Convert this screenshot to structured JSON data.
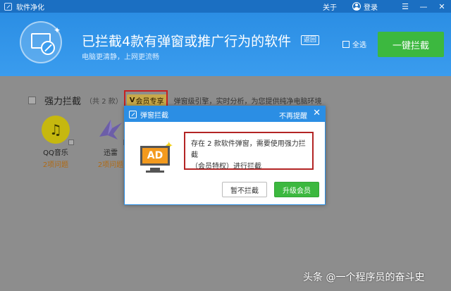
{
  "titlebar": {
    "app_title": "软件净化",
    "about": "关于",
    "login": "登录",
    "menu_glyph": "☰",
    "minimize_glyph": "—",
    "close_glyph": "✕"
  },
  "header": {
    "headline": "已拦截4款有弹窗或推广行为的软件",
    "return_label": "返回",
    "subline": "电脑更清静，上网更流畅",
    "select_all_label": "全选",
    "block_all_label": "一键拦截"
  },
  "section": {
    "title": "强力拦截",
    "count": "（共 2 款）",
    "vip_label": "会员专享",
    "vip_mark": "V",
    "description": "弹窗级引擎，实时分析，为您提供纯净电脑环境"
  },
  "apps": [
    {
      "name": "QQ音乐",
      "issues": "2项问题"
    },
    {
      "name": "迅雷",
      "issues": "2项问题"
    }
  ],
  "dialog": {
    "title": "弹窗拦截",
    "no_remind": "不再提醒",
    "close_glyph": "✕",
    "ad_label": "AD",
    "message_line1": "存在 2 款软件弹窗，需要使用强力拦截",
    "message_line2": "（会员特权）进行拦截",
    "cancel_label": "暂不拦截",
    "upgrade_label": "升级会员"
  },
  "watermark": "头条 @一个程序员的奋斗史",
  "colors": {
    "primary_blue": "#2b8ee4",
    "green_button": "#3cb83f",
    "highlight_red": "#c62020",
    "vip_gold": "#c7a94a"
  }
}
